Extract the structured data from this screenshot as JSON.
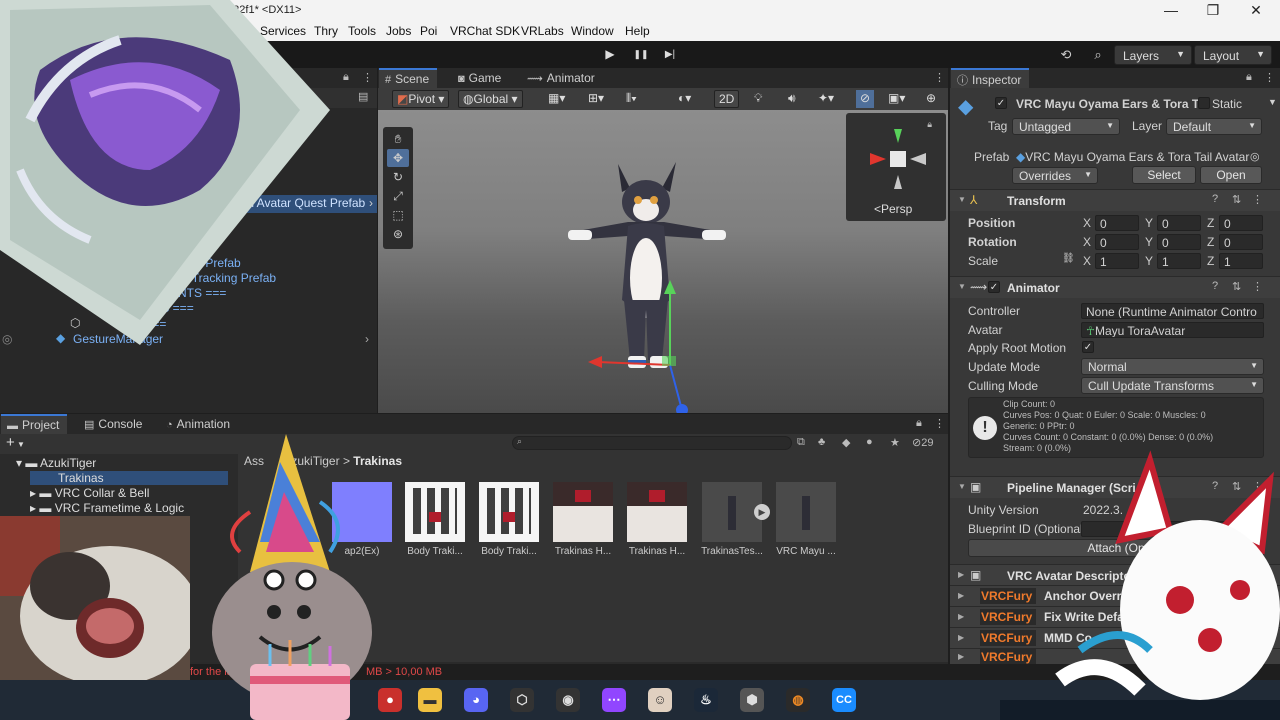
{
  "window": {
    "title": "3.22f1* <DX11>",
    "controls": {
      "minimize": "—",
      "maximize": "❐",
      "close": "✕"
    }
  },
  "menu": [
    "Services",
    "Thry",
    "Tools",
    "Jobs",
    "Poi",
    "VRChat SDK",
    "VRLabs",
    "Window",
    "Help"
  ],
  "toolbar": {
    "play": "▶",
    "pause": "❚❚",
    "step": "▶|",
    "history_icon": "history-icon",
    "search_icon": "search-icon",
    "layers": "Layers",
    "layout": "Layout"
  },
  "hierarchy": {
    "rows": [
      {
        "text": "Tail Avatar Quest Prefab",
        "color": "#7bb1f5",
        "selected": true
      },
      {
        "text": "Loco Prefab",
        "color": "#7bb1f5"
      },
      {
        "text": "Face Tracking Prefab",
        "color": "#7bb1f5"
      },
      {
        "text": "GARMENTS ===",
        "color": "#7bb1f5"
      },
      {
        "text": "OTHES ===",
        "color": "#7bb1f5"
      },
      {
        "text": "EMS ===",
        "color": "#7bb1f5"
      },
      {
        "text": "GestureManager",
        "color": "#7bb1f5"
      }
    ]
  },
  "scene": {
    "tabs": [
      "Scene",
      "Game",
      "Animator"
    ],
    "toolbar": {
      "pivot": "Pivot",
      "global": "Global",
      "mode_2d": "2D"
    },
    "gizmo_label": "<Persp"
  },
  "project": {
    "tabs": [
      "Project",
      "Console",
      "Animation"
    ],
    "add": "+",
    "tree": [
      {
        "text": "AzukiTiger",
        "depth": 0,
        "selected": false
      },
      {
        "text": "Trakinas",
        "depth": 1,
        "selected": true
      },
      {
        "text": "VRC Collar & Bell",
        "depth": 1,
        "selected": false
      },
      {
        "text": "VRC Frametime & Logic",
        "depth": 1,
        "selected": false
      }
    ],
    "breadcrumb": {
      "root": "Ass",
      "mid": "zukiTiger",
      "sep": ">",
      "current": "Trakinas"
    },
    "hidden_count": "29",
    "assets": [
      "ap2(Ex)",
      "Body Traki...",
      "Body Traki...",
      "Trakinas H...",
      "Trakinas H...",
      "TrakinasTes...",
      "VRC Mayu ..."
    ],
    "status_text": "for the la",
    "status_size": "MB > 10,00 MB"
  },
  "inspector": {
    "tab": "Inspector",
    "object_name": "VRC Mayu Oyama Ears & Tora T",
    "static_label": "Static",
    "tag_label": "Tag",
    "tag_value": "Untagged",
    "layer_label": "Layer",
    "layer_value": "Default",
    "prefab_label": "Prefab",
    "prefab_value": "VRC Mayu Oyama Ears & Tora Tail Avatar",
    "overrides": "Overrides",
    "select": "Select",
    "open": "Open",
    "transform": {
      "title": "Transform",
      "rows": [
        {
          "label": "Position",
          "x": "0",
          "y": "0",
          "z": "0"
        },
        {
          "label": "Rotation",
          "x": "0",
          "y": "0",
          "z": "0"
        },
        {
          "label": "Scale",
          "x": "1",
          "y": "1",
          "z": "1"
        }
      ],
      "axis": [
        "X",
        "Y",
        "Z"
      ]
    },
    "animator": {
      "title": "Animator",
      "controller_label": "Controller",
      "controller_value": "None (Runtime Animator Contro",
      "avatar_label": "Avatar",
      "avatar_value": "Mayu ToraAvatar",
      "root_motion_label": "Apply Root Motion",
      "update_label": "Update Mode",
      "update_value": "Normal",
      "culling_label": "Culling Mode",
      "culling_value": "Cull Update Transforms",
      "info": [
        "Clip Count: 0",
        "Curves Pos: 0 Quat: 0 Euler: 0 Scale: 0 Muscles: 0",
        "Generic: 0 PPtr: 0",
        "Curves Count: 0 Constant: 0 (0.0%) Dense: 0 (0.0%)",
        "Stream: 0 (0.0%)"
      ]
    },
    "pipeline": {
      "title": "Pipeline Manager (Scri",
      "unity_version_label": "Unity Version",
      "unity_version_value": "2022.3.",
      "blueprint_label": "Blueprint ID (Optional",
      "attach": "Attach (Op"
    },
    "descriptor_title": "VRC Avatar Descriptor",
    "vrcfury_badge": "VRCFury",
    "vrcfury": [
      "Anchor Override Fi",
      "Fix Write Default",
      "MMD Co",
      ""
    ]
  },
  "colors": {
    "accent": "#3b78d4",
    "link_blue": "#7bb1f5",
    "vrcfury": "#ef7a2c",
    "selection": "#2f4f7a"
  }
}
